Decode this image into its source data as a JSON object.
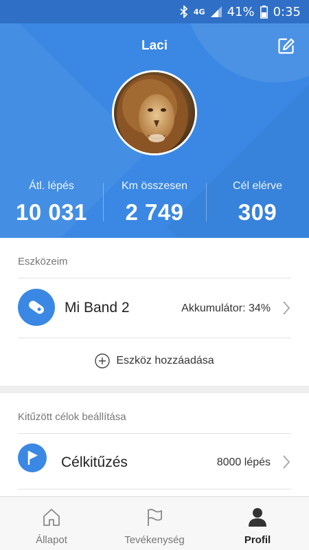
{
  "status_bar": {
    "network": "4G",
    "battery_percent": "41%",
    "time": "0:35",
    "icons": [
      "bluetooth-icon",
      "signal-icon",
      "battery-icon"
    ]
  },
  "header": {
    "user_name": "Laci",
    "edit_icon": "edit-icon",
    "avatar": "lion-avatar",
    "stats": [
      {
        "label": "Átl. lépés",
        "value": "10 031"
      },
      {
        "label": "Km összesen",
        "value": "2 749"
      },
      {
        "label": "Cél elérve",
        "value": "309"
      }
    ]
  },
  "devices": {
    "title": "Eszközeim",
    "device_name": "Mi Band 2",
    "battery_label": "Akkumulátor: 34%",
    "add_label": "Eszköz hozzáadása"
  },
  "goals": {
    "title": "Kitűzött célok beállítása",
    "goal_name": "Célkitűzés",
    "goal_value": "8000 lépés"
  },
  "nav": {
    "items": [
      {
        "label": "Állapot",
        "icon": "home-icon"
      },
      {
        "label": "Tevékenység",
        "icon": "flag-icon"
      },
      {
        "label": "Profil",
        "icon": "person-icon",
        "active": true
      }
    ]
  },
  "colors": {
    "accent": "#3a88e3",
    "status_bar": "#2f6fc6"
  }
}
